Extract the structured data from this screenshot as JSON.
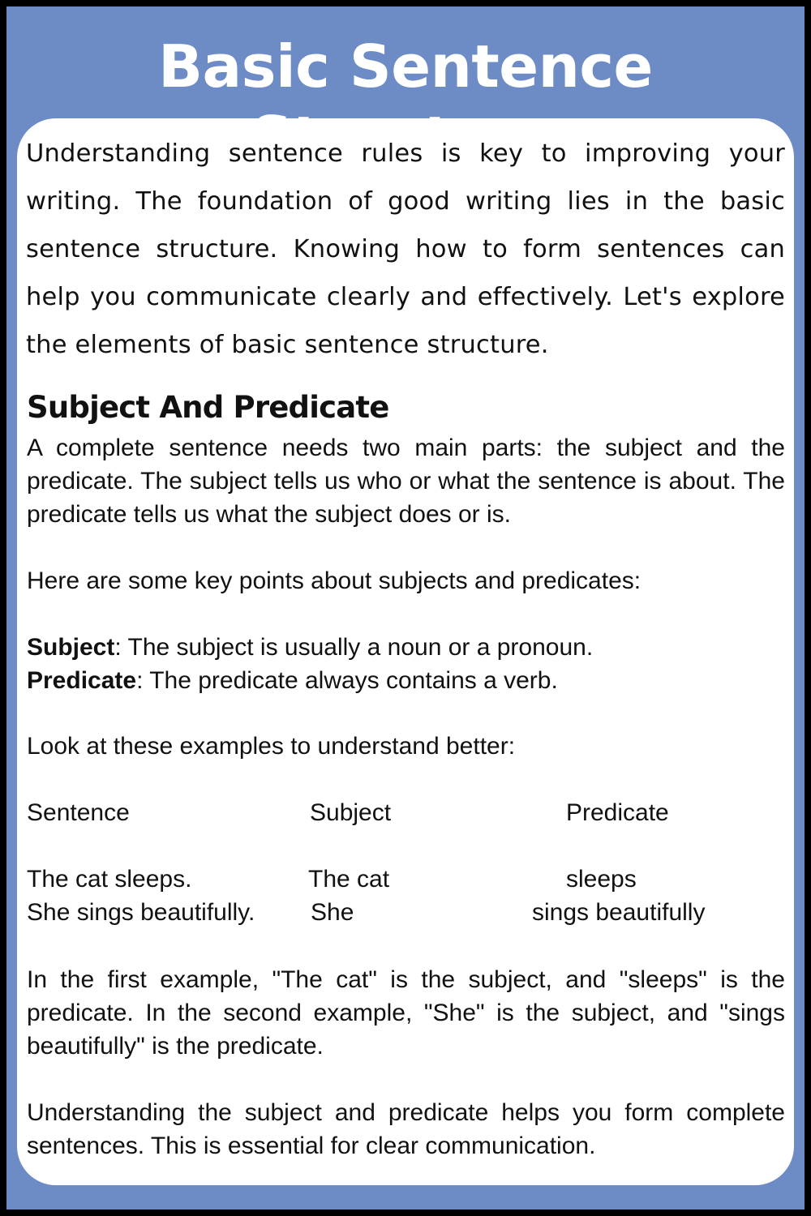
{
  "title": "Basic Sentence Structure",
  "intro": "Understanding sentence rules is key to improving your writing. The foundation of good writing lies in the basic sentence structure. Knowing how to form sentences can help you communicate clearly and effectively. Let's explore the elements of basic sentence structure.",
  "section": {
    "heading": "Subject And Predicate",
    "paragraph1": "A complete sentence needs two main parts: the subject and the predicate. The subject tells us who or what the sentence is about. The predicate tells us what the subject does or is.",
    "paragraph2": "Here are some key points about subjects and predicates:",
    "points": [
      {
        "term": "Subject",
        "text": ": The subject is usually a noun or a pronoun."
      },
      {
        "term": "Predicate",
        "text": ": The predicate always contains a verb."
      }
    ],
    "paragraph3": "Look at these examples to understand better:",
    "table": {
      "headers": [
        "Sentence",
        "Subject",
        "Predicate"
      ],
      "rows": [
        [
          "The cat sleeps.",
          "The cat",
          "sleeps"
        ],
        [
          "She sings beautifully.",
          "She",
          "sings beautifully"
        ]
      ]
    },
    "paragraph4": "In the first example, \"The cat\" is the subject, and \"sleeps\" is the predicate. In the second example, \"She\" is the subject, and \"sings beautifully\" is the predicate.",
    "paragraph5": "Understanding the subject and predicate helps you form complete sentences. This is essential for clear communication."
  },
  "colors": {
    "frame": "#000000",
    "panel": "#6d8bc4",
    "card": "#ffffff",
    "text": "#111111"
  }
}
